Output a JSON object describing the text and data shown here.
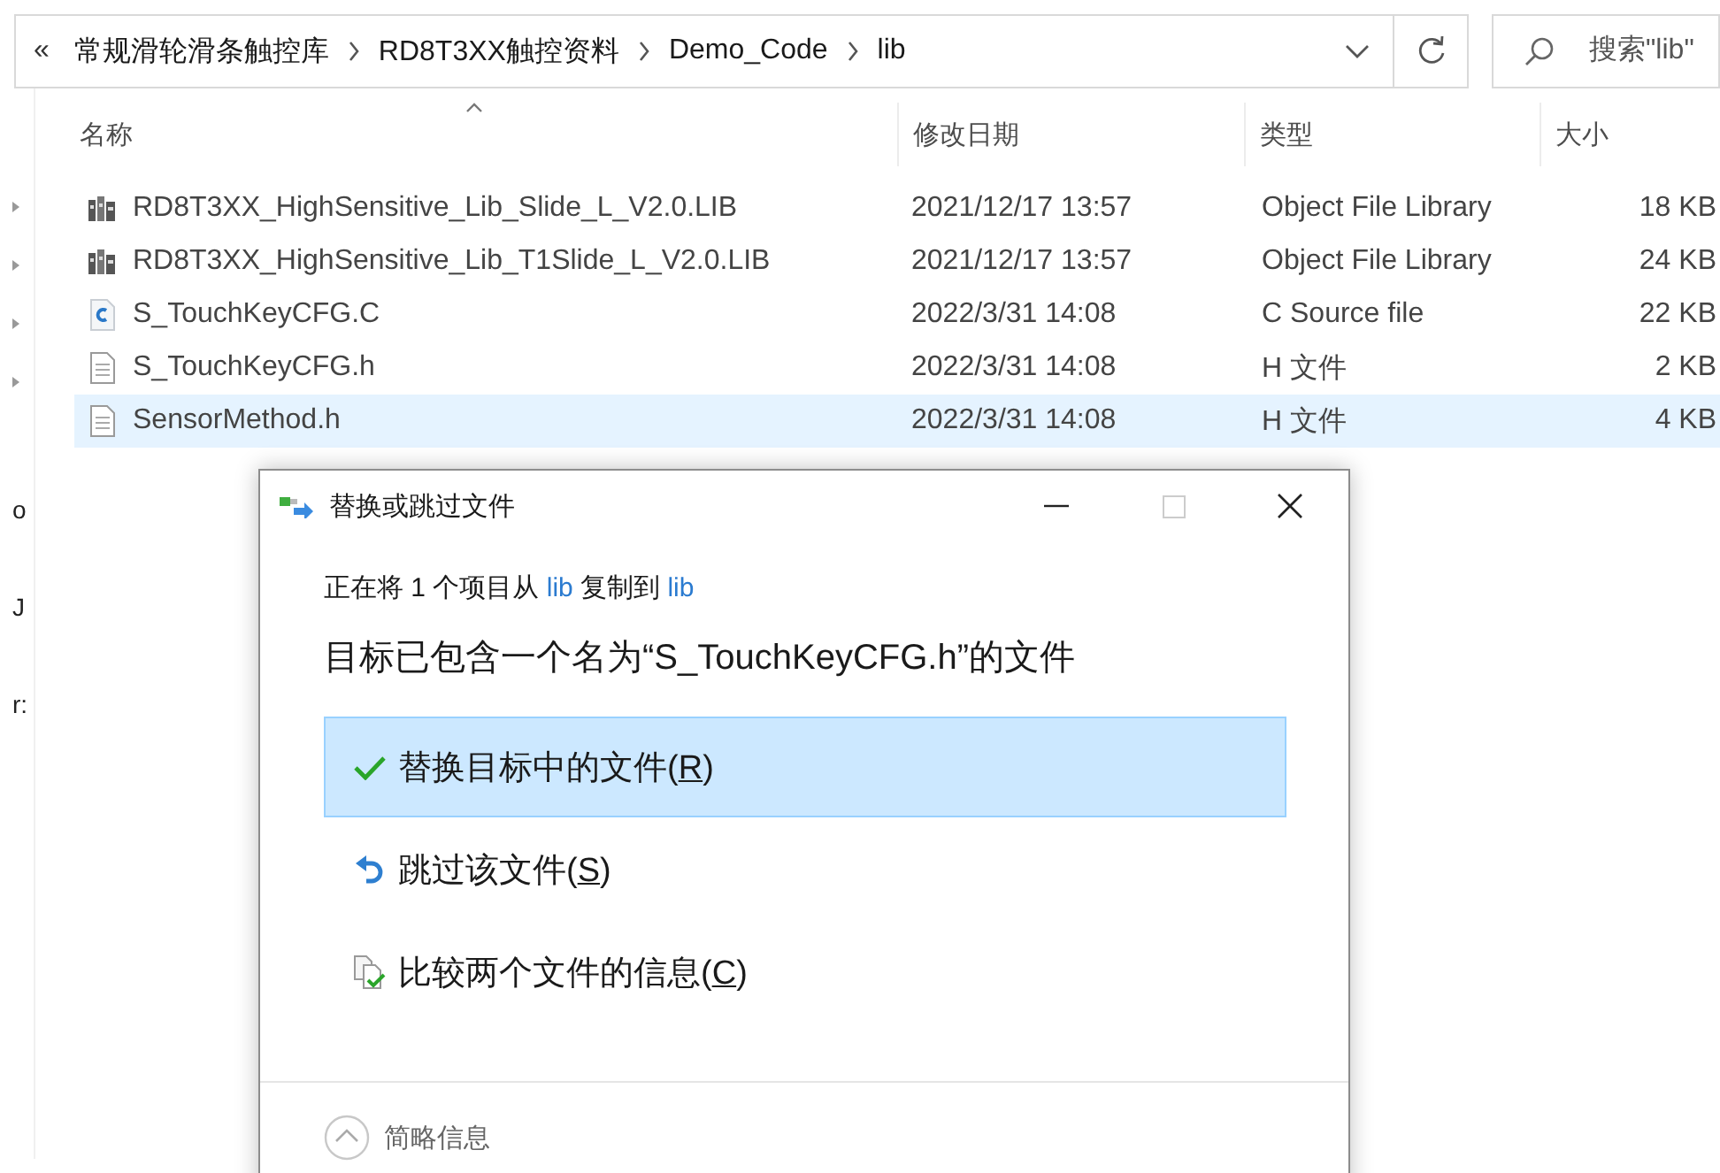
{
  "address_bar": {
    "overflow": "«",
    "breadcrumbs": [
      "常规滑轮滑条触控库",
      "RD8T3XX触控资料",
      "Demo_Code",
      "lib"
    ],
    "search": {
      "placeholder": "搜索\"lib\""
    }
  },
  "sidebar": {
    "items": [
      {
        "kind": "expander"
      },
      {
        "kind": "expander"
      },
      {
        "kind": "expander"
      },
      {
        "kind": "expander"
      },
      {
        "kind": "label",
        "label": "o"
      },
      {
        "kind": "label",
        "label": "J"
      },
      {
        "kind": "label",
        "label": "r:"
      }
    ]
  },
  "file_list": {
    "columns": [
      "名称",
      "修改日期",
      "类型",
      "大小"
    ],
    "rows": [
      {
        "kind": "library",
        "name": "RD8T3XX_HighSensitive_Lib_Slide_L_V2.0.LIB",
        "modified": "2021/12/17 13:57",
        "type": "Object File Library",
        "size": "18 KB",
        "selected": false
      },
      {
        "kind": "library",
        "name": "RD8T3XX_HighSensitive_Lib_T1Slide_L_V2.0.LIB",
        "modified": "2021/12/17 13:57",
        "type": "Object File Library",
        "size": "24 KB",
        "selected": false
      },
      {
        "kind": "c-source",
        "name": "S_TouchKeyCFG.C",
        "modified": "2022/3/31 14:08",
        "type": "C Source file",
        "size": "22 KB",
        "selected": false
      },
      {
        "kind": "text",
        "name": "S_TouchKeyCFG.h",
        "modified": "2022/3/31 14:08",
        "type": "H 文件",
        "size": "2 KB",
        "selected": false
      },
      {
        "kind": "text",
        "name": "SensorMethod.h",
        "modified": "2022/3/31 14:08",
        "type": "H 文件",
        "size": "4 KB",
        "selected": true
      }
    ]
  },
  "dialog": {
    "title": "替换或跳过文件",
    "controls": [
      {
        "kind": "minimize",
        "disabled": false
      },
      {
        "kind": "maximize",
        "disabled": true
      },
      {
        "kind": "close",
        "disabled": false
      }
    ],
    "copy_line": [
      {
        "kind": "text",
        "text": "正在将 1 个项目从 "
      },
      {
        "kind": "link",
        "text": "lib"
      },
      {
        "kind": "text",
        "text": " 复制到 "
      },
      {
        "kind": "link",
        "text": "lib"
      }
    ],
    "headline": "目标已包含一个名为“S_TouchKeyCFG.h”的文件",
    "options": [
      {
        "kind": "check",
        "prefix": "替换目标中的文件(",
        "access_key": "R",
        "suffix": ")",
        "selected": true
      },
      {
        "kind": "undo",
        "prefix": "跳过该文件(",
        "access_key": "S",
        "suffix": ")",
        "selected": false
      },
      {
        "kind": "compare",
        "prefix": "比较两个文件的信息(",
        "access_key": "C",
        "suffix": ")",
        "selected": false
      }
    ],
    "footer": {
      "label": "简略信息",
      "expanded": false
    }
  }
}
